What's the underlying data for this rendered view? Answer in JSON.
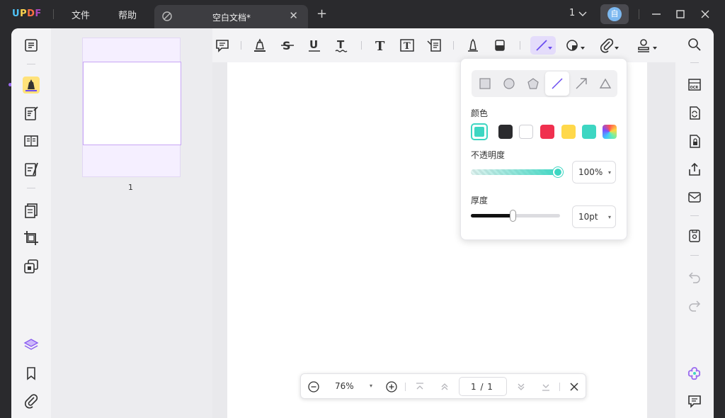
{
  "app": {
    "logo": {
      "u": "U",
      "p": "P",
      "d": "D",
      "f": "F"
    }
  },
  "menu": {
    "file": "文件",
    "help": "帮助"
  },
  "tab": {
    "title": "空白文档*",
    "close": "✕"
  },
  "new_tab": "+",
  "header": {
    "page_count": "1",
    "avatar_initial": "自"
  },
  "thumbnail": {
    "page_label": "1"
  },
  "popover": {
    "color_label": "颜色",
    "opacity_label": "不透明度",
    "opacity_value": "100%",
    "opacity_fraction": 1.0,
    "thickness_label": "厚度",
    "thickness_value": "10pt",
    "thickness_fraction": 0.48,
    "colors": {
      "selected": "#3dd6c2",
      "swatches": [
        "#2b2b2e",
        "#ffffff",
        "#f0304f",
        "#ffd84a",
        "#3dd6c2",
        "gradient"
      ]
    },
    "caret": "▾"
  },
  "zoombar": {
    "zoom": "76%",
    "page": "1 / 1",
    "caret": "▾"
  },
  "colors": {
    "accent": "#9b6cf0",
    "teal": "#3dd6c2",
    "titlebar": "#2a2a2d"
  }
}
